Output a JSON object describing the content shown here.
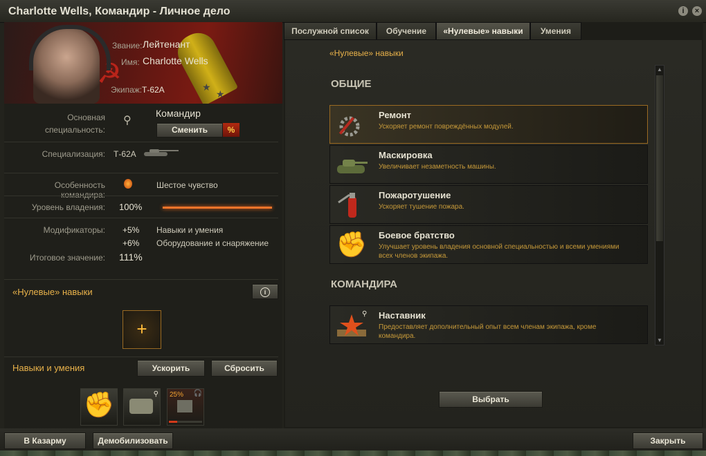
{
  "window": {
    "title": "Charlotte Wells, Командир - Личное дело"
  },
  "profile": {
    "rank_label": "Звание:",
    "rank": "Лейтенант",
    "name_label": "Имя:",
    "name": "Charlotte Wells",
    "crew_label": "Экипаж:",
    "crew": "Т-62А"
  },
  "specialty": {
    "label": "Основная специальность:",
    "value": "Командир",
    "change_button": "Сменить",
    "percent_badge": "%"
  },
  "specialization": {
    "label": "Специализация:",
    "tank": "Т-62А"
  },
  "feature": {
    "label": "Особенность командира:",
    "value": "Шестое чувство"
  },
  "mastery": {
    "label": "Уровень владения:",
    "value": "100%",
    "fill": 1.0
  },
  "modifiers": {
    "label": "Модификаторы:",
    "items": [
      {
        "value": "+5%",
        "desc": "Навыки и умения"
      },
      {
        "value": "+6%",
        "desc": "Оборудование и снаряжение"
      }
    ]
  },
  "total": {
    "label": "Итоговое значение:",
    "value": "111%"
  },
  "zero_skills": {
    "title": "«Нулевые» навыки",
    "add_symbol": "+"
  },
  "skills_section": {
    "title": "Навыки и умения",
    "accelerate_button": "Ускорить",
    "reset_button": "Сбросить",
    "training_progress": "25%"
  },
  "tabs": [
    {
      "label": "Послужной список"
    },
    {
      "label": "Обучение"
    },
    {
      "label": "«Нулевые» навыки"
    },
    {
      "label": "Умения"
    }
  ],
  "panel": {
    "header": "«Нулевые» навыки",
    "categories": [
      {
        "title": "ОБЩИЕ"
      },
      {
        "title": "КОМАНДИРА"
      }
    ],
    "skills": [
      {
        "name": "Ремонт",
        "desc": "Ускоряет ремонт повреждённых модулей."
      },
      {
        "name": "Маскировка",
        "desc": "Увеличивает незаметность машины."
      },
      {
        "name": "Пожаротушение",
        "desc": "Ускоряет тушение пожара."
      },
      {
        "name": "Боевое братство",
        "desc": "Улучшает уровень владения основной специальностью и всеми умениями всех членов экипажа."
      },
      {
        "name": "Наставник",
        "desc": "Предоставляет дополнительный опыт всем членам экипажа, кроме командира."
      }
    ],
    "select_button": "Выбрать"
  },
  "footer": {
    "barracks_button": "В Казарму",
    "demobilize_button": "Демобилизовать",
    "close_button": "Закрыть"
  }
}
